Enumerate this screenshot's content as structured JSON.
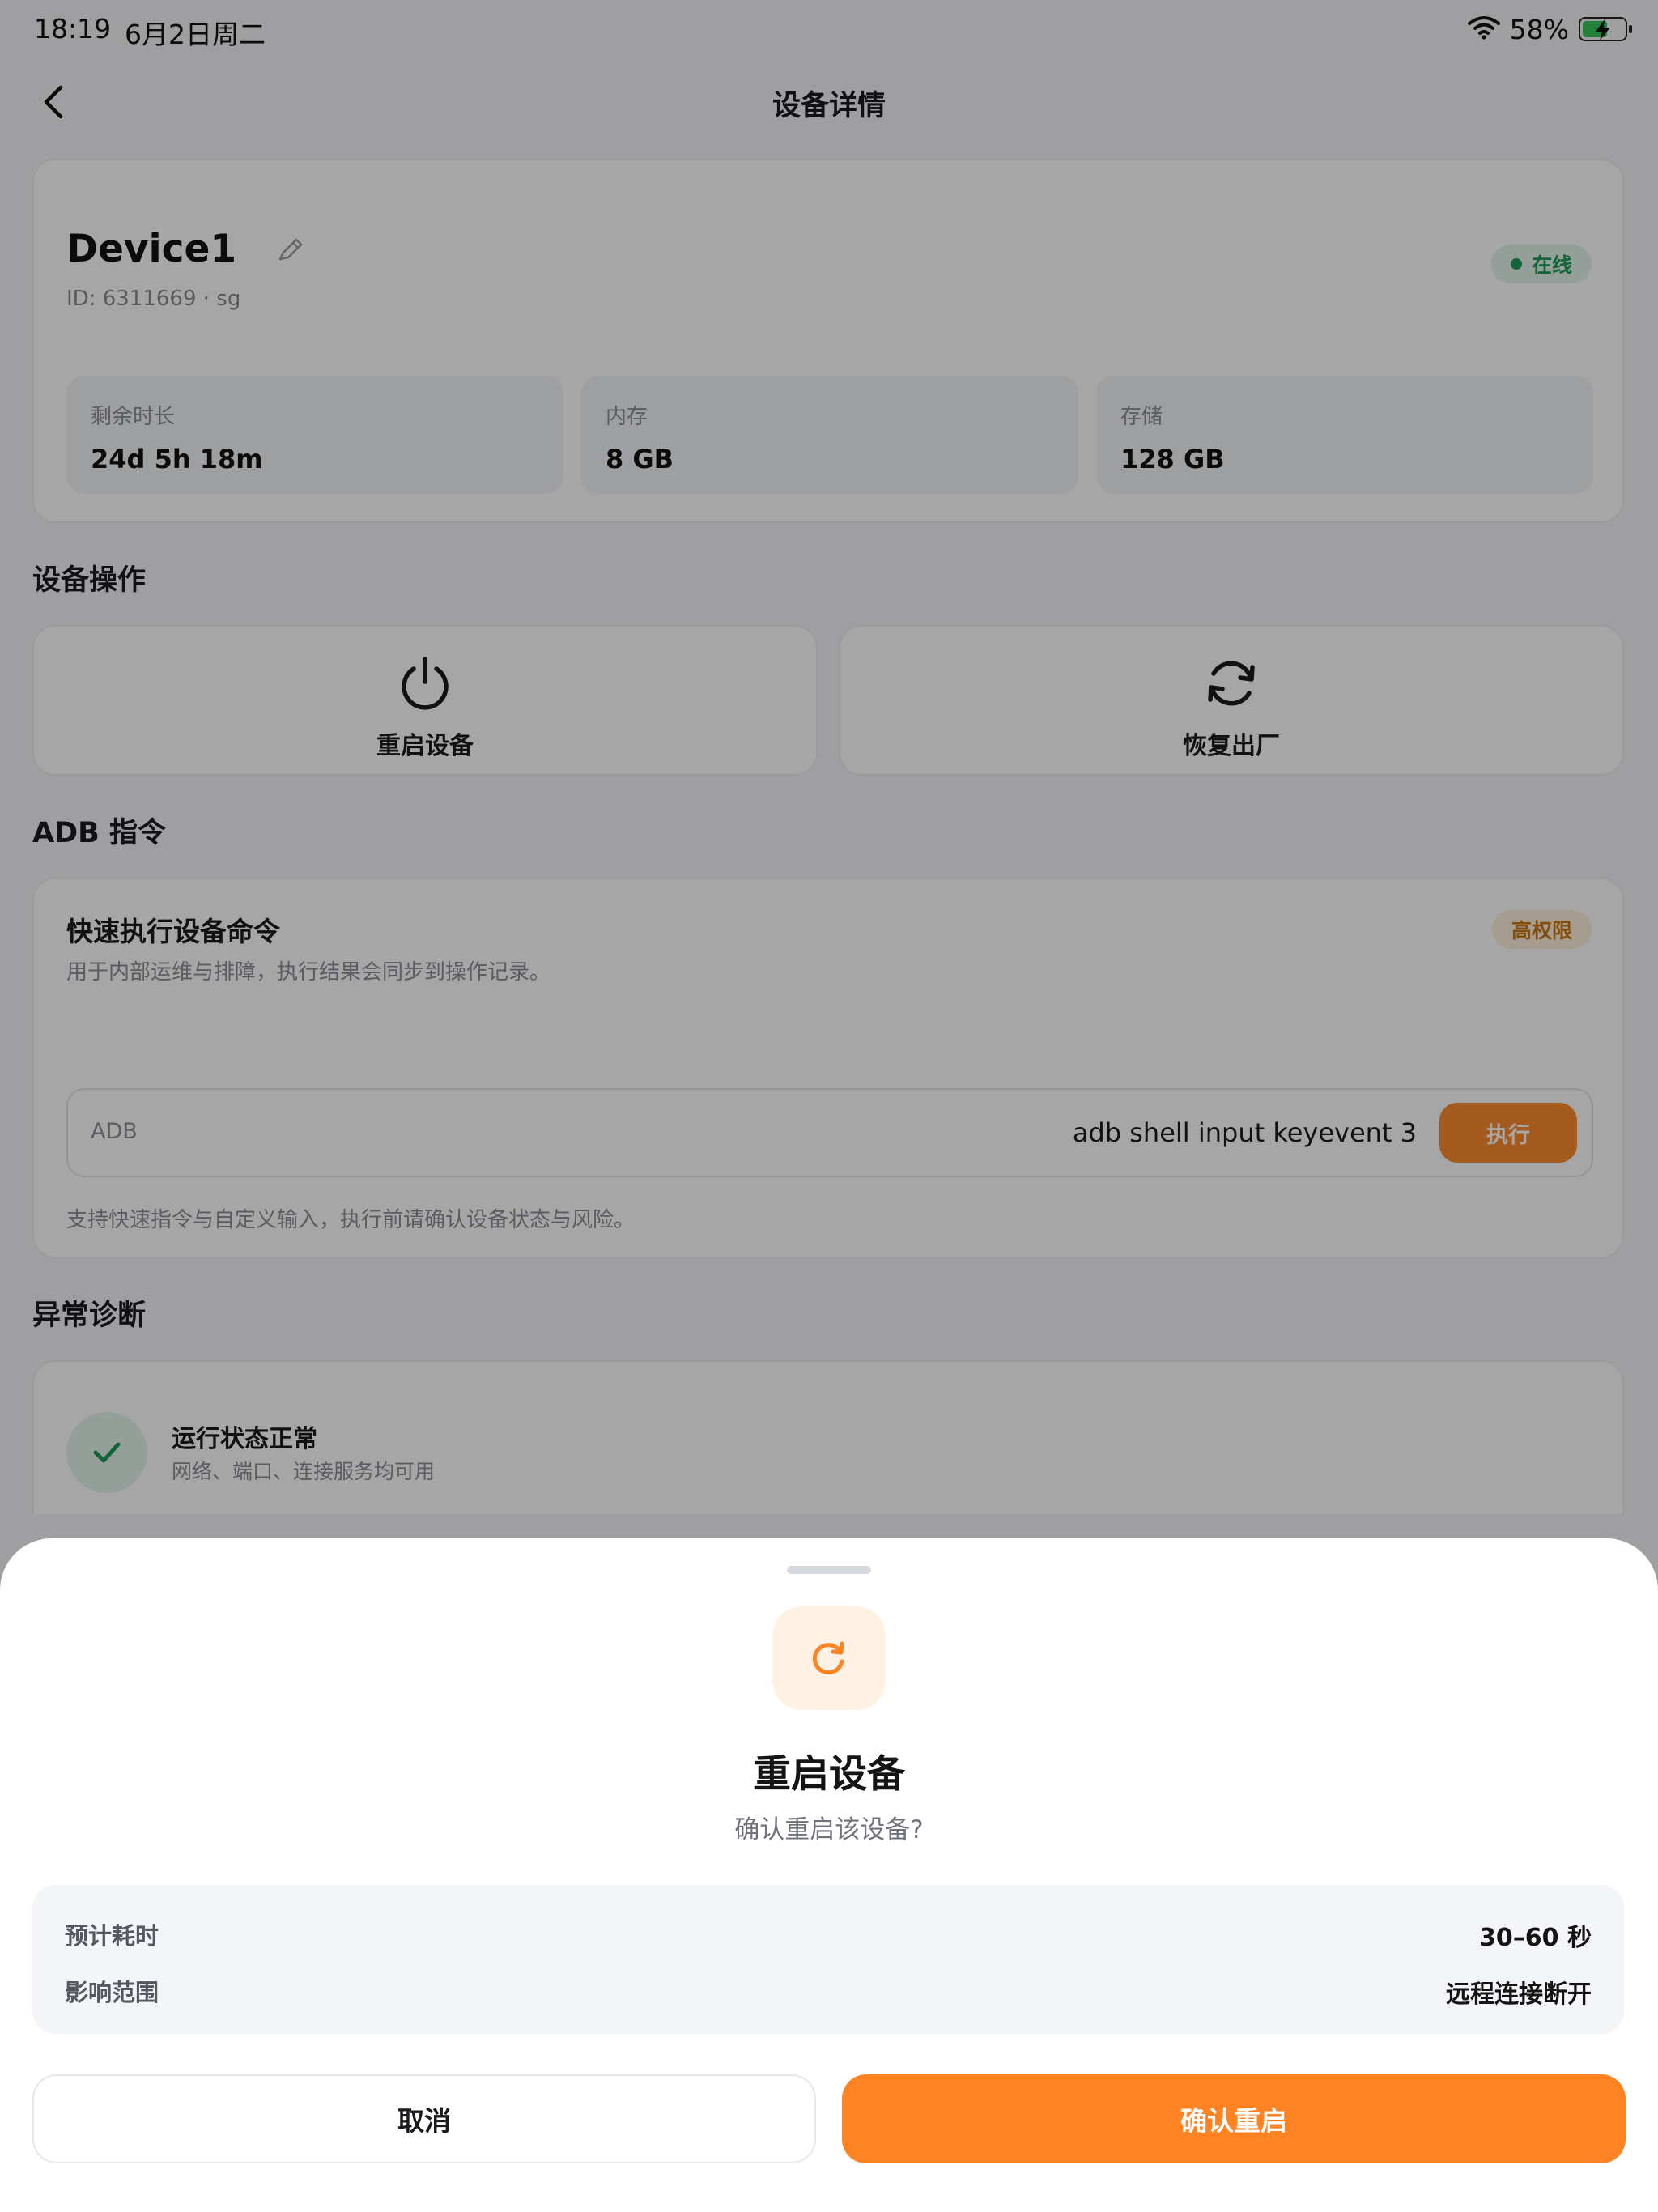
{
  "status_bar": {
    "time": "18:19",
    "date": "6月2日周二",
    "battery_pct": "58%",
    "battery_level": 0.58,
    "charging": true
  },
  "nav": {
    "title": "设备详情"
  },
  "device": {
    "name": "Device1",
    "id_line": "ID: 6311669 · sg",
    "status": "在线",
    "stats": [
      {
        "label": "剩余时长",
        "value": "24d 5h 18m"
      },
      {
        "label": "内存",
        "value": "8 GB"
      },
      {
        "label": "存储",
        "value": "128 GB"
      }
    ]
  },
  "operations": {
    "title": "设备操作",
    "items": [
      {
        "label": "重启设备",
        "icon": "power-icon"
      },
      {
        "label": "恢复出厂",
        "icon": "refresh-icon"
      }
    ]
  },
  "adb": {
    "section_title": "ADB 指令",
    "card_title": "快速执行设备命令",
    "card_desc": "用于内部运维与排障，执行结果会同步到操作记录。",
    "badge": "高权限",
    "input_label": "ADB",
    "command": "adb shell input keyevent 3",
    "execute_label": "执行",
    "hint": "支持快速指令与自定义输入，执行前请确认设备状态与风险。"
  },
  "diagnosis": {
    "section_title": "异常诊断",
    "status_title": "运行状态正常",
    "status_sub": "网络、端口、连接服务均可用"
  },
  "sheet": {
    "title": "重启设备",
    "subtitle": "确认重启该设备?",
    "info": [
      {
        "label": "预计耗时",
        "value": "30–60 秒"
      },
      {
        "label": "影响范围",
        "value": "远程连接断开"
      }
    ],
    "cancel_label": "取消",
    "confirm_label": "确认重启"
  },
  "colors": {
    "accent": "#ff8323",
    "online": "#1f9a5a",
    "warning": "#c97812"
  }
}
